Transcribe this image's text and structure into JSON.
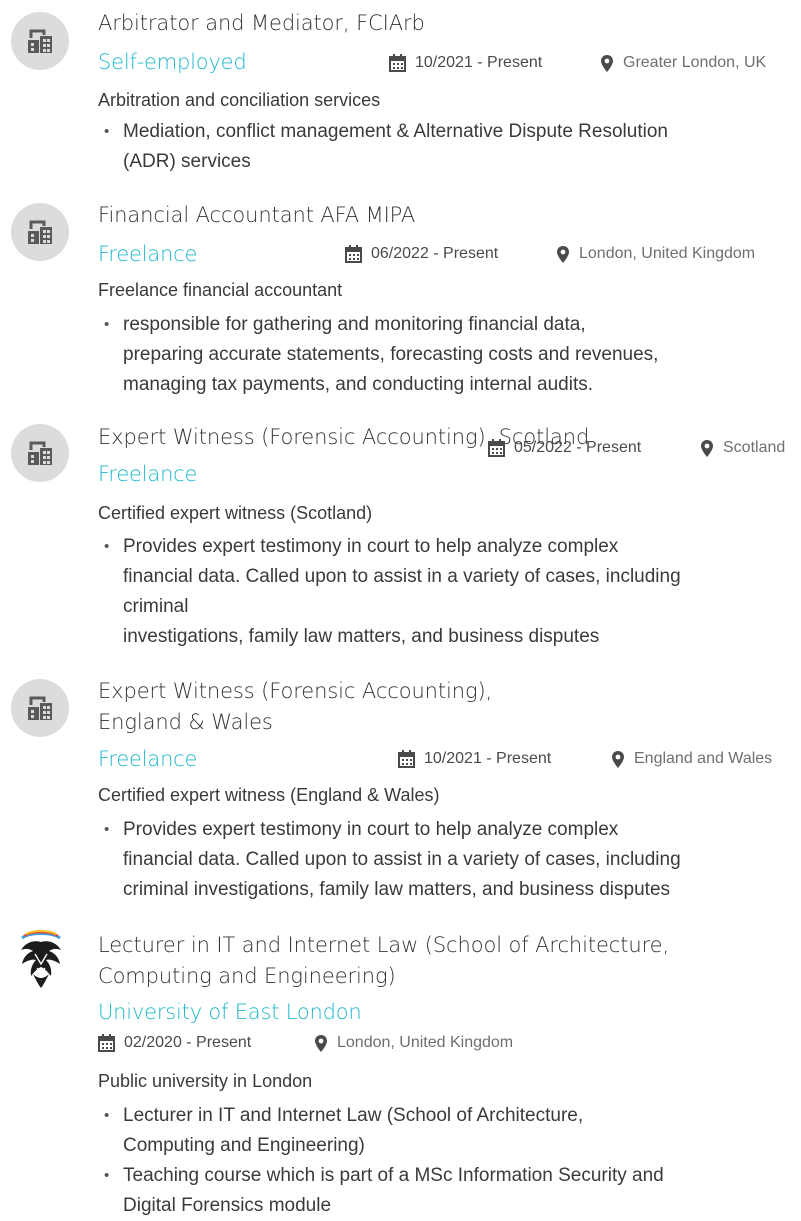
{
  "entries": [
    {
      "title_lines": [
        "Arbitrator and Mediator, FCIArb"
      ],
      "company": "Self-employed",
      "date": "10/2021 - Present",
      "location": "Greater London, UK",
      "description": "Arbitration and conciliation services",
      "bullets": [
        [
          "Mediation, conflict management & Alternative Dispute Resolution",
          "(ADR) services"
        ]
      ],
      "logo_icon": "building-icon"
    },
    {
      "title_lines": [
        "Financial Accountant AFA MIPA"
      ],
      "company": "Freelance",
      "date": "06/2022 - Present",
      "location": "London, United Kingdom",
      "description": "Freelance financial accountant",
      "bullets": [
        [
          "responsible for gathering  and monitoring financial data,",
          "preparing accurate statements, forecasting costs and revenues,",
          "managing tax payments, and conducting internal audits."
        ]
      ],
      "logo_icon": "building-icon"
    },
    {
      "title_lines": [
        "Expert Witness (Forensic Accounting),  Scotland"
      ],
      "company": "Freelance",
      "date": "05/2022 - Present",
      "location": "Scotland",
      "description": "Certified expert witness (Scotland)",
      "bullets": [
        [
          "Provides expert testimony in court to help analyze complex",
          "financial data. Called upon to assist in a variety of cases, including",
          "criminal",
          "investigations, family law matters, and business disputes"
        ]
      ],
      "logo_icon": "building-icon"
    },
    {
      "title_lines": [
        "Expert Witness (Forensic Accounting),",
        "England & Wales"
      ],
      "company": "Freelance",
      "date": "10/2021 - Present",
      "location": "England and Wales",
      "description": "Certified expert witness (England & Wales)",
      "bullets": [
        [
          "Provides expert testimony in court to help analyze complex",
          "financial data. Called upon to assist in a variety of cases, including",
          "criminal investigations, family law matters, and business disputes"
        ]
      ],
      "logo_icon": "building-icon"
    },
    {
      "title_lines": [
        "Lecturer in IT and Internet Law (School of Architecture,",
        "Computing and Engineering)"
      ],
      "company": "University of East London",
      "date": "02/2020 - Present",
      "location": "London, United Kingdom",
      "description": "Public university in London",
      "bullets": [
        [
          "Lecturer in IT and Internet Law (School of Architecture,",
          "Computing and Engineering)"
        ],
        [
          "Teaching course which is part of a MSc Information Security and",
          "Digital Forensics module"
        ]
      ],
      "logo_icon": "university-crest-icon"
    }
  ],
  "colors": {
    "accent": "#1fb8c9",
    "icon_bg": "#dcdcdc",
    "icon_fg": "#555555",
    "text": "#383838"
  },
  "icons": {
    "date": "calendar-icon",
    "location": "map-pin-icon"
  }
}
